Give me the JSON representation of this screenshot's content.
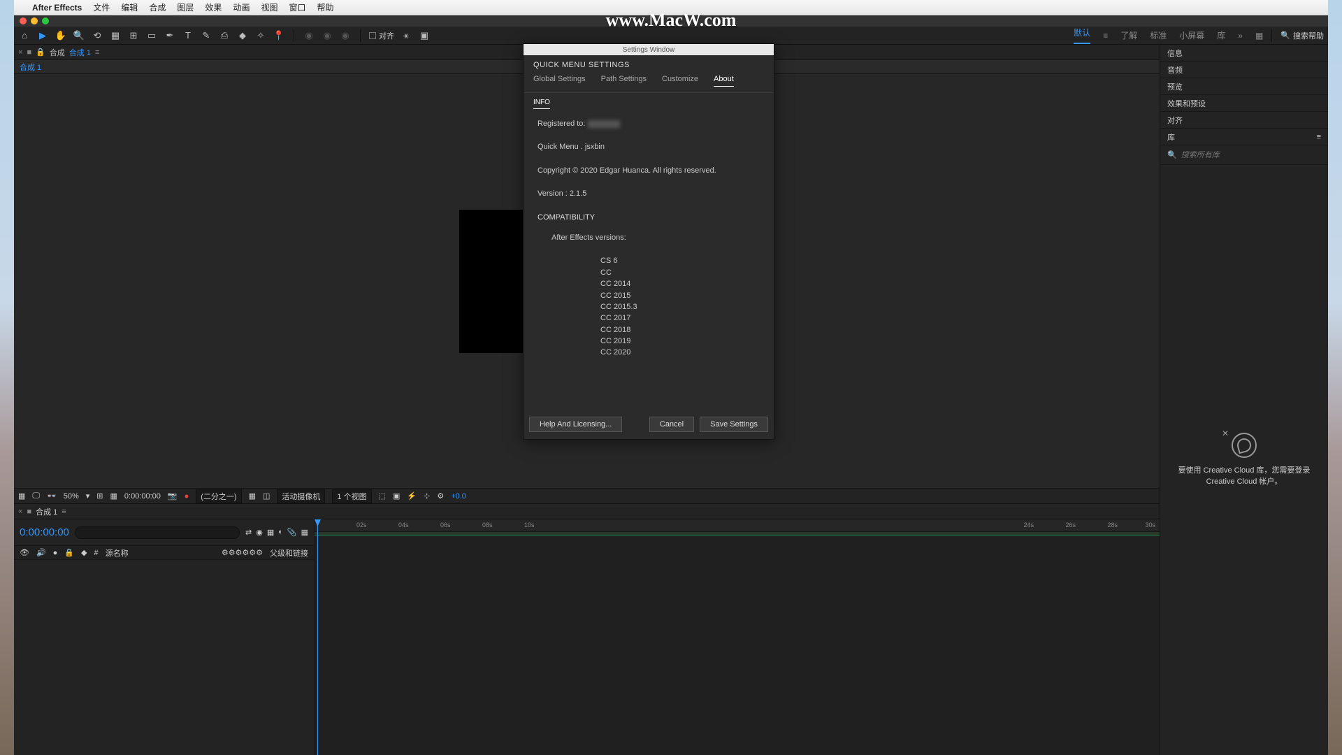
{
  "watermark": "www.MacW.com",
  "menubar": {
    "app": "After Effects",
    "items": [
      "文件",
      "编辑",
      "合成",
      "图层",
      "效果",
      "动画",
      "视图",
      "窗口",
      "帮助"
    ]
  },
  "workspaces": {
    "active": "默认",
    "items": [
      "默认",
      "了解",
      "标准",
      "小屏幕",
      "库"
    ],
    "search_placeholder": "搜索帮助"
  },
  "toolbar": {
    "snap": "对齐"
  },
  "comp": {
    "prefix": "合成",
    "name": "合成 1",
    "breadcrumb": "合成 1"
  },
  "viewer_footer": {
    "zoom": "50%",
    "time": "0:00:00:00",
    "res": "(二分之一)",
    "camera": "活动摄像机",
    "views": "1 个视图",
    "exposure": "+0.0"
  },
  "timeline": {
    "tab_prefix": "",
    "tab": "合成 1",
    "timecode": "0:00:00:00",
    "cols": {
      "num": "#",
      "name": "源名称",
      "parent": "父级和链接"
    },
    "ticks": [
      "02s",
      "04s",
      "06s",
      "08s",
      "10s",
      "24s",
      "26s",
      "28s",
      "30s"
    ]
  },
  "panels": {
    "info": "信息",
    "audio": "音频",
    "preview": "预览",
    "effects": "效果和预设",
    "align": "对齐",
    "library": "库",
    "lib_search_placeholder": "搜索所有库",
    "lib_msg": "要使用 Creative Cloud 库，您需要登录 Creative Cloud 帐户。"
  },
  "dialog": {
    "title": "Settings Window",
    "header": "QUICK MENU SETTINGS",
    "tabs": [
      "Global Settings",
      "Path Settings",
      "Customize",
      "About"
    ],
    "active_tab": "About",
    "subtab": "INFO",
    "registered_label": "Registered to:",
    "script_name": "Quick Menu . jsxbin",
    "copyright": "Copyright © 2020  Edgar Huanca. All rights reserved.",
    "version": "Version : 2.1.5",
    "compat_header": "COMPATIBILITY",
    "compat_sub": "After Effects versions:",
    "versions": [
      "CS 6",
      "CC",
      "CC 2014",
      "CC 2015",
      "CC 2015.3",
      "CC 2017",
      "CC 2018",
      "CC 2019",
      "CC 2020"
    ],
    "buttons": {
      "help": "Help And Licensing...",
      "cancel": "Cancel",
      "save": "Save Settings"
    }
  }
}
